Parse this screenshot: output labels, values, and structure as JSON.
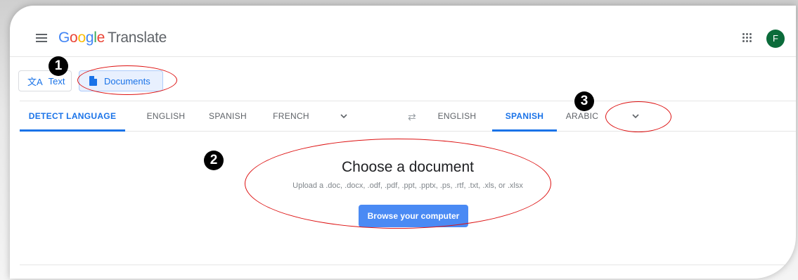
{
  "appbar": {
    "logo": {
      "G": "G",
      "o1": "o",
      "o2": "o",
      "g": "g",
      "l": "l",
      "e": "e"
    },
    "product": "Translate",
    "avatar_initial": "F"
  },
  "modes": {
    "text_label": "Text",
    "documents_label": "Documents"
  },
  "source_languages": [
    "DETECT LANGUAGE",
    "ENGLISH",
    "SPANISH",
    "FRENCH"
  ],
  "target_languages": [
    "ENGLISH",
    "SPANISH",
    "ARABIC"
  ],
  "main": {
    "title": "Choose a document",
    "subtitle": "Upload a .doc, .docx, .odf, .pdf, .ppt, .pptx, .ps, .rtf, .txt, .xls, or .xlsx",
    "browse_label": "Browse your computer"
  },
  "annotations": [
    "1",
    "2",
    "3"
  ],
  "colors": {
    "accent": "#1a73e8",
    "annotation": "#dd1111",
    "avatar": "#0b6b3a"
  }
}
